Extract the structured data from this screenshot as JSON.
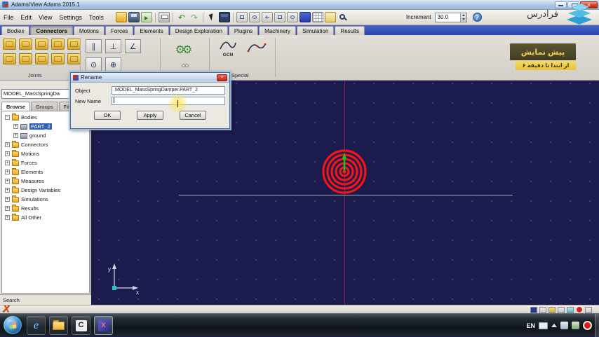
{
  "window": {
    "title": "Adams/View Adams 2015.1"
  },
  "menu": {
    "items": [
      "File",
      "Edit",
      "View",
      "Settings",
      "Tools"
    ]
  },
  "toolbar": {
    "increment_label": "Increment",
    "increment_value": "30.0",
    "help_label": "?",
    "icons": [
      "open-database",
      "save-database",
      "import-file",
      "print",
      "undo",
      "redo",
      "select-cursor",
      "view-cube",
      "pan-view",
      "rotate-view",
      "zoom-view",
      "fit-view",
      "front-view",
      "shaded-render",
      "working-grid",
      "table-editor",
      "magnifier"
    ]
  },
  "ribbon": {
    "tabs": [
      "Bodies",
      "Connectors",
      "Motions",
      "Forces",
      "Elements",
      "Design Exploration",
      "Plugins",
      "Machinery",
      "Simulation",
      "Results"
    ],
    "active_tab": "Connectors",
    "group_labels": [
      "Joints",
      "Special"
    ],
    "gcn_label": "GCN",
    "joint_icons": [
      "fixed-joint",
      "revolute-joint",
      "translational-joint",
      "cylindrical-joint",
      "spherical-joint",
      "planar-joint",
      "constant-velocity-joint",
      "universal-joint",
      "screw-joint",
      "inline-joint"
    ],
    "primitive_icons": [
      "parallel-axes",
      "perpendicular",
      "orientation",
      "inplane",
      "inline"
    ],
    "special_icons": [
      "gear-coupler",
      "pulley-coupler",
      "gcn-constraint",
      "spline-curve"
    ]
  },
  "sidebar": {
    "model_selector": "MODEL_MassSpringDa",
    "tabs": [
      "Browse",
      "Groups",
      "Filters"
    ],
    "tree": [
      {
        "label": "Bodies",
        "exp": "-"
      },
      {
        "label": "PART_2",
        "exp": "+"
      },
      {
        "label": "ground",
        "exp": "+"
      },
      {
        "label": "Connectors",
        "exp": "+"
      },
      {
        "label": "Motions",
        "exp": "+"
      },
      {
        "label": "Forces",
        "exp": "+"
      },
      {
        "label": "Elements",
        "exp": "+"
      },
      {
        "label": "Measures",
        "exp": "+"
      },
      {
        "label": "Design Variables",
        "exp": "+"
      },
      {
        "label": "Simulations",
        "exp": "+"
      },
      {
        "label": "Results",
        "exp": "+"
      },
      {
        "label": "All Other",
        "exp": "+"
      }
    ],
    "search_label": "Search"
  },
  "dialog": {
    "title": "Rename",
    "object_label": "Object",
    "object_value": ".MODEL_MassSpringDamper.PART_2",
    "new_name_label": "New Name",
    "new_name_value": "",
    "buttons": {
      "ok": "OK",
      "apply": "Apply",
      "cancel": "Cancel"
    }
  },
  "viewport": {
    "axis_x": "x",
    "axis_y": "y"
  },
  "watermark": {
    "brand": "فرادرس",
    "banner_title": "پیش نمایش",
    "banner_subtitle": "از ابتدا تا دقیقه ۶"
  },
  "statusbar": {
    "icons": [
      "adams-logo",
      "model-toggle",
      "view-mode",
      "icons-toggle",
      "render-mode",
      "grid-toggle",
      "info",
      "help"
    ]
  },
  "taskbar": {
    "language": "EN",
    "icons": [
      "start-orb",
      "internet-explorer",
      "windows-explorer",
      "camtasia",
      "adams-view",
      "keyboard-layout",
      "tray-expand",
      "network",
      "volume",
      "record-indicator",
      "show-desktop"
    ]
  },
  "colors": {
    "viewport_bg": "#1b1b4e",
    "grid_dot": "#45457c",
    "crosshair_vertical": "#8a2548",
    "crosshair_horizontal": "#c2c2ce",
    "part_red": "#f31616",
    "marker_green": "#19c519",
    "selection_blue": "#2f62b8",
    "banner_dark": "#4e4930",
    "banner_yellow": "#f0cf4f",
    "brand_blue": "#53bce6"
  }
}
